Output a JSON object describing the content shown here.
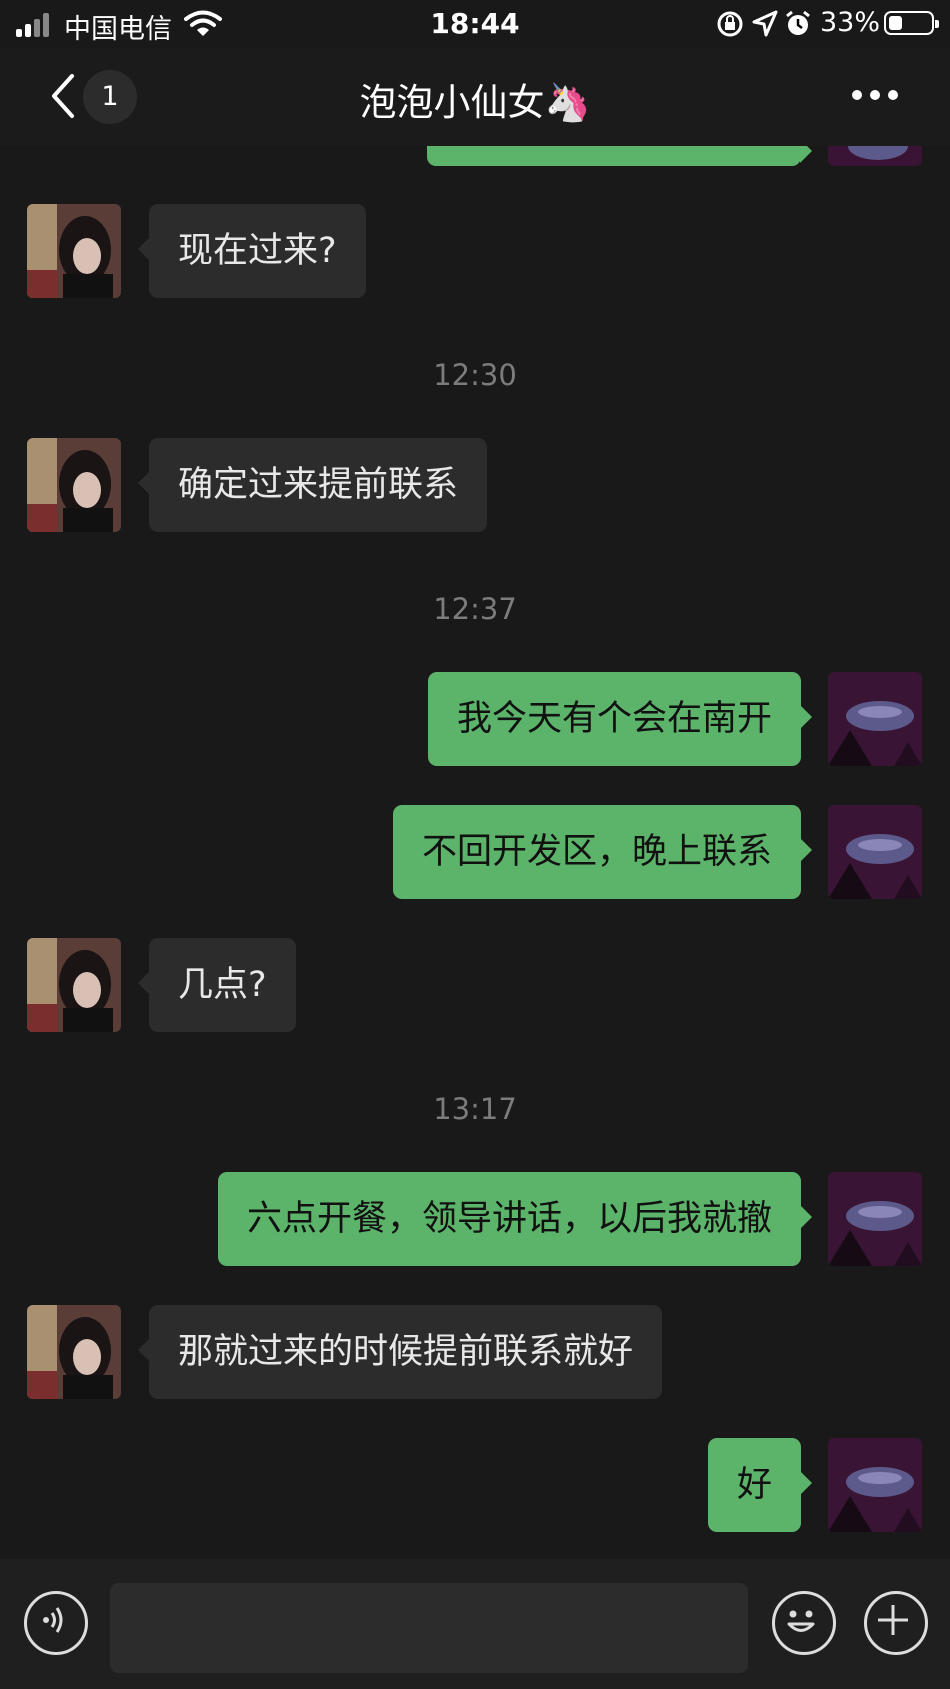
{
  "status_bar": {
    "carrier": "中国电信",
    "time": "18:44",
    "battery": "33%"
  },
  "header": {
    "unread_count": "1",
    "title": "泡泡小仙女🦄"
  },
  "messages": [
    {
      "type": "in",
      "text": "现在过来?"
    },
    {
      "type": "time",
      "text": "12:30"
    },
    {
      "type": "in",
      "text": "确定过来提前联系"
    },
    {
      "type": "time",
      "text": "12:37"
    },
    {
      "type": "out",
      "text": "我今天有个会在南开"
    },
    {
      "type": "out",
      "text": "不回开发区，晚上联系"
    },
    {
      "type": "in",
      "text": "几点?"
    },
    {
      "type": "time",
      "text": "13:17"
    },
    {
      "type": "out",
      "text": "六点开餐，领导讲话，以后我就撤"
    },
    {
      "type": "in",
      "text": "那就过来的时候提前联系就好"
    },
    {
      "type": "out",
      "text": "好"
    }
  ],
  "input": {
    "voice_icon": "voice-icon",
    "emoji_icon": "emoji-icon",
    "plus_icon": "plus-icon"
  }
}
